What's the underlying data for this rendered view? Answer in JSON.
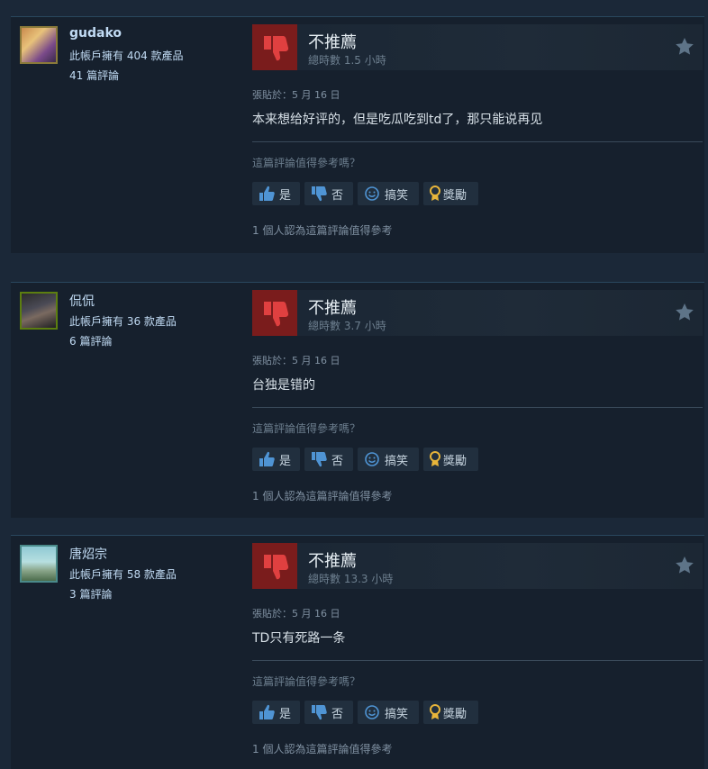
{
  "reviews": [
    {
      "username": "gudako",
      "username_bold": true,
      "products_owned": "此帳戶擁有 404 款產品",
      "review_count": "41 篇評論",
      "verdict": "不推薦",
      "hours": "總時數 1.5 小時",
      "posted": "張貼於：5 月 16 日",
      "content": "本来想给好评的，但是吃瓜吃到td了，那只能说再见",
      "helpful_question": "這篇評論值得參考嗎？",
      "buttons": {
        "yes": "是",
        "no": "否",
        "funny": "搞笑",
        "award": "獎勵"
      },
      "found_helpful": "1 個人認為這篇評論值得參考"
    },
    {
      "username": "侃侃",
      "username_bold": false,
      "products_owned": "此帳戶擁有 36 款產品",
      "review_count": "6 篇評論",
      "verdict": "不推薦",
      "hours": "總時數 3.7 小時",
      "posted": "張貼於：5 月 16 日",
      "content": "台独是错的",
      "helpful_question": "這篇評論值得參考嗎？",
      "buttons": {
        "yes": "是",
        "no": "否",
        "funny": "搞笑",
        "award": "獎勵"
      },
      "found_helpful": "1 個人認為這篇評論值得參考"
    },
    {
      "username": "唐炤宗",
      "username_bold": false,
      "products_owned": "此帳戶擁有 58 款產品",
      "review_count": "3 篇評論",
      "verdict": "不推薦",
      "hours": "總時數 13.3 小時",
      "posted": "張貼於：5 月 16 日",
      "content": "TD只有死路一条",
      "helpful_question": "這篇評論值得參考嗎？",
      "buttons": {
        "yes": "是",
        "no": "否",
        "funny": "搞笑",
        "award": "獎勵"
      },
      "found_helpful": "1 個人認為這篇評論值得參考"
    }
  ],
  "icons": {
    "verdict": "thumbs-down-icon",
    "star": "star-icon",
    "yes": "thumbs-up-icon",
    "no": "thumbs-down-icon",
    "funny": "smiley-icon",
    "award": "award-ribbon-icon"
  },
  "colors": {
    "background": "#1b2838",
    "card": "#16202d",
    "thumb_down_bg": "#7a1c1c",
    "thumb_down_fg": "#e04040",
    "award": "#e8b53a",
    "blue_icon": "#4f94d4"
  }
}
